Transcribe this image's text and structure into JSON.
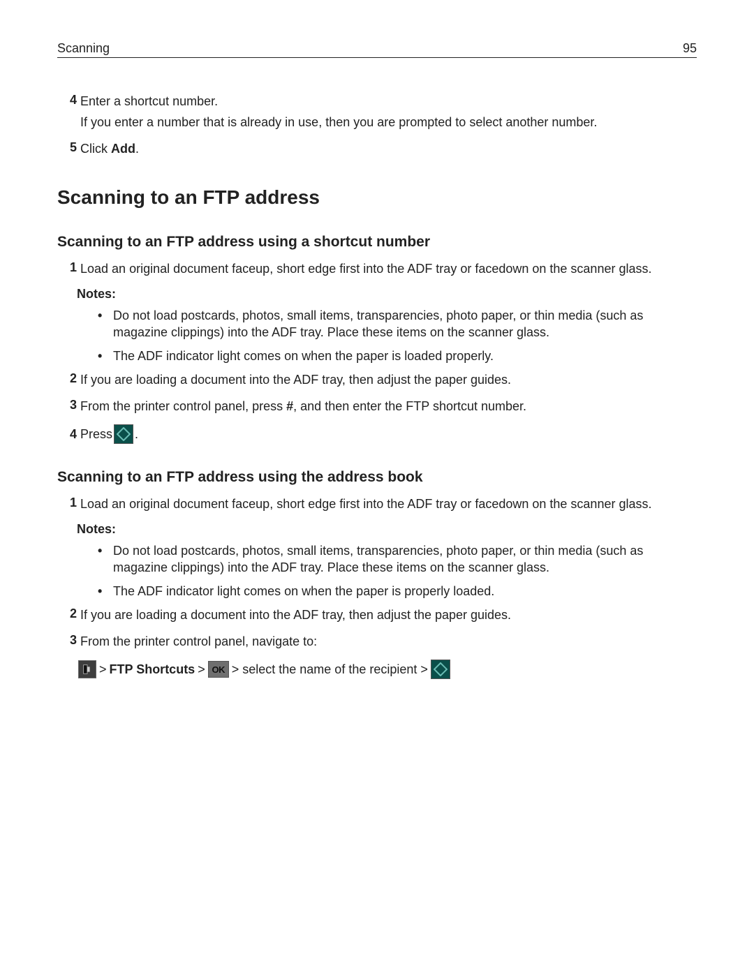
{
  "header": {
    "section": "Scanning",
    "page_number": "95"
  },
  "intro_steps": {
    "four": {
      "line1": "Enter a shortcut number.",
      "line2": "If you enter a number that is already in use, then you are prompted to select another number."
    },
    "five": {
      "prefix": "Click ",
      "add": "Add",
      "suffix": "."
    }
  },
  "section_title": "Scanning to an FTP address",
  "sub1": {
    "title": "Scanning to an FTP address using a shortcut number",
    "step1": "Load an original document faceup, short edge first into the ADF tray or facedown on the scanner glass.",
    "notes_label": "Notes:",
    "bullets": {
      "b1": "Do not load postcards, photos, small items, transparencies, photo paper, or thin media (such as magazine clippings) into the ADF tray. Place these items on the scanner glass.",
      "b2": "The ADF indicator light comes on when the paper is loaded properly."
    },
    "step2": "If you are loading a document into the ADF tray, then adjust the paper guides.",
    "step3": {
      "a": "From the printer control panel, press ",
      "hash": "#",
      "b": ", and then enter the FTP shortcut number."
    },
    "step4": {
      "press": "Press ",
      "period": "."
    }
  },
  "sub2": {
    "title": "Scanning to an FTP address using the address book",
    "step1": "Load an original document faceup, short edge first into the ADF tray or facedown on the scanner glass.",
    "notes_label": "Notes:",
    "bullets": {
      "b1": "Do not load postcards, photos, small items, transparencies, photo paper, or thin media (such as magazine clippings) into the ADF tray. Place these items on the scanner glass.",
      "b2": "The ADF indicator light comes on when the paper is properly loaded."
    },
    "step2": "If you are loading a document into the ADF tray, then adjust the paper guides.",
    "step3": "From the printer control panel, navigate to:",
    "nav": {
      "sep": " > ",
      "ftp_label": "FTP Shortcuts",
      "ok_text": "OK",
      "tail": " > select the name of the recipient > "
    }
  }
}
